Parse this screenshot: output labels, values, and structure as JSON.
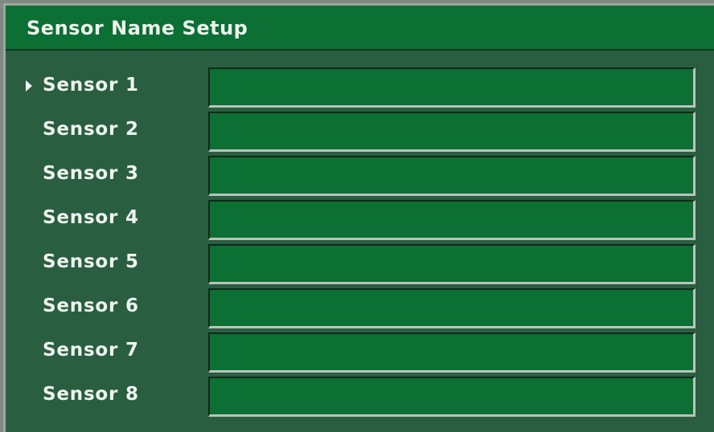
{
  "window": {
    "title": "Sensor Name Setup"
  },
  "sensors": [
    {
      "label": "Sensor 1",
      "value": "",
      "selected": true
    },
    {
      "label": "Sensor 2",
      "value": "",
      "selected": false
    },
    {
      "label": "Sensor 3",
      "value": "",
      "selected": false
    },
    {
      "label": "Sensor 4",
      "value": "",
      "selected": false
    },
    {
      "label": "Sensor 5",
      "value": "",
      "selected": false
    },
    {
      "label": "Sensor 6",
      "value": "",
      "selected": false
    },
    {
      "label": "Sensor 7",
      "value": "",
      "selected": false
    },
    {
      "label": "Sensor 8",
      "value": "",
      "selected": false
    }
  ],
  "colors": {
    "panel_background": "#2a5e40",
    "title_bar": "#0c6f34",
    "field_background": "#0c6f34",
    "text": "#eef3ef"
  },
  "icons": {
    "selection_pointer": "triangle-right-icon"
  }
}
